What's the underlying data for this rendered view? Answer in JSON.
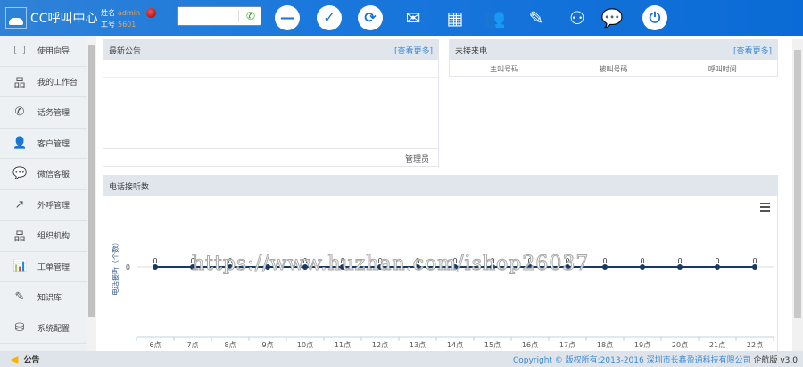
{
  "header": {
    "app_title": "CC呼叫中心",
    "name_label": "姓名",
    "name_value": "admin",
    "id_label": "工号",
    "id_value": "5601",
    "toolbar": [
      {
        "icon": "minus-circle-icon",
        "glyph": "—",
        "circ": true
      },
      {
        "icon": "check-circle-icon",
        "glyph": "✓",
        "circ": true
      },
      {
        "icon": "refresh-circle-icon",
        "glyph": "⟳",
        "circ": true
      },
      {
        "icon": "voicemail-envelope-icon",
        "glyph": "✉"
      },
      {
        "icon": "keypad-icon",
        "glyph": "▦"
      },
      {
        "icon": "contacts-phone-icon",
        "glyph": "👥"
      },
      {
        "icon": "edit-note-icon",
        "glyph": "✎"
      },
      {
        "icon": "meeting-icon",
        "glyph": "⚇"
      },
      {
        "icon": "wechat-icon",
        "glyph": "💬"
      },
      {
        "icon": "power-icon",
        "glyph": "⏻",
        "circ": true
      }
    ]
  },
  "sidebar": {
    "items": [
      {
        "label": "使用向导",
        "icon": "monitor-check-icon",
        "glyph": "🖵"
      },
      {
        "label": "我的工作台",
        "icon": "org-chart-icon",
        "glyph": "品"
      },
      {
        "label": "话务管理",
        "icon": "phone-icon",
        "glyph": "✆"
      },
      {
        "label": "客户管理",
        "icon": "customer-icon",
        "glyph": "👤"
      },
      {
        "label": "微信客服",
        "icon": "wechat-icon",
        "glyph": "💬"
      },
      {
        "label": "外呼管理",
        "icon": "outbound-call-icon",
        "glyph": "↗"
      },
      {
        "label": "组织机构",
        "icon": "org-chart-icon",
        "glyph": "品"
      },
      {
        "label": "工单管理",
        "icon": "bar-chart-icon",
        "glyph": "📊"
      },
      {
        "label": "知识库",
        "icon": "document-edit-icon",
        "glyph": "✎"
      },
      {
        "label": "系统配置",
        "icon": "database-gear-icon",
        "glyph": "⛁"
      }
    ],
    "notice": "公告"
  },
  "panels": {
    "announcements": {
      "title": "最新公告",
      "more": "[查看更多]",
      "footer": "管理员"
    },
    "missed_calls": {
      "title": "未接来电",
      "more": "[查看更多]",
      "columns": [
        "主叫号码",
        "被叫号码",
        "呼叫时间"
      ]
    },
    "calls_chart": {
      "title": "电话接听数"
    }
  },
  "chart_data": {
    "type": "line",
    "title": "电话接听数",
    "ylabel": "电话接听（个数）",
    "xlabel": "",
    "categories": [
      "6点",
      "7点",
      "8点",
      "9点",
      "10点",
      "11点",
      "12点",
      "13点",
      "14点",
      "15点",
      "16点",
      "17点",
      "18点",
      "19点",
      "20点",
      "21点",
      "22点"
    ],
    "series": [
      {
        "name": "电话接听数",
        "values": [
          0,
          0,
          0,
          0,
          0,
          0,
          0,
          0,
          0,
          0,
          0,
          0,
          0,
          0,
          0,
          0,
          0
        ]
      }
    ],
    "yticks": [
      "0"
    ],
    "color": "#163a63"
  },
  "watermark": "https://www.huzhan.com/ishop26037",
  "footer": {
    "copyright": "Copyright © 版权所有:2013-2016 深圳市长鑫盈通科技有限公司",
    "edition": "企航版 v3.0"
  }
}
